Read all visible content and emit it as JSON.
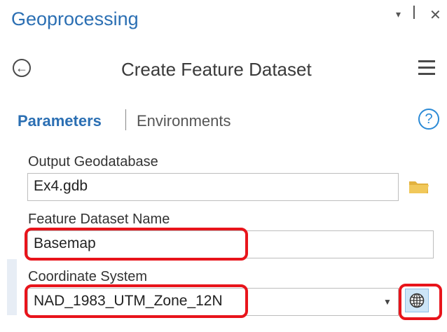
{
  "window": {
    "title": "Geoprocessing",
    "controls": {
      "dropdown": "▾",
      "pin": "ꟾ",
      "close": "✕"
    }
  },
  "tool": {
    "title": "Create Feature Dataset",
    "back_icon": "back-arrow-icon",
    "menu_icon": "hamburger-menu-icon"
  },
  "tabs": {
    "parameters": "Parameters",
    "environments": "Environments",
    "help_symbol": "?"
  },
  "params": {
    "output_geodatabase": {
      "label": "Output Geodatabase",
      "value": "Ex4.gdb",
      "icon": "folder-icon"
    },
    "feature_dataset_name": {
      "label": "Feature Dataset Name",
      "value": "Basemap"
    },
    "coordinate_system": {
      "label": "Coordinate System",
      "value": "NAD_1983_UTM_Zone_12N",
      "icon": "globe-icon"
    }
  },
  "colors": {
    "accent_blue": "#2b6fb3",
    "highlight_red": "#e8141b",
    "globe_button_bg": "#cde5f7"
  }
}
